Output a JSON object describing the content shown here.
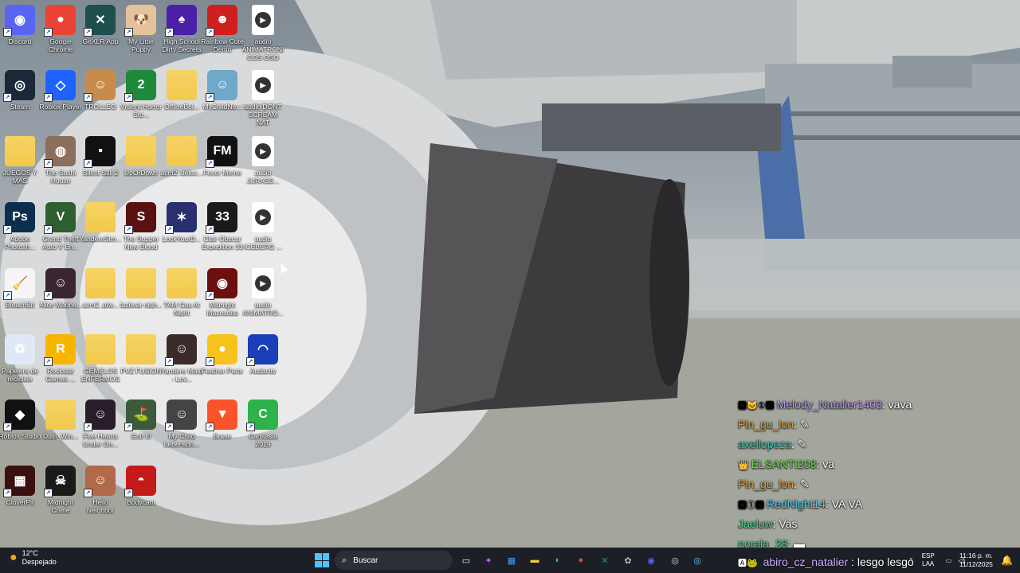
{
  "desktop_icons": [
    {
      "label": "Discord",
      "icon": "discord-icon",
      "color": "#5865f2",
      "glyph": "◉"
    },
    {
      "label": "Google Chrome",
      "icon": "chrome-icon",
      "color": "#ea4335",
      "glyph": "●"
    },
    {
      "label": "GeXLR App",
      "icon": "app-icon",
      "color": "#1e4f4f",
      "glyph": "✕"
    },
    {
      "label": "My Little Puppy",
      "icon": "puppy-icon",
      "color": "#e4c29a",
      "glyph": "🐶"
    },
    {
      "label": "High School Dirty Secrets",
      "icon": "game-icon",
      "color": "#4b1fa8",
      "glyph": "♠"
    },
    {
      "label": "Rainbow Cute Demo",
      "icon": "bear-icon",
      "color": "#d01f1f",
      "glyph": "☻"
    },
    {
      "label": "audio ANIMATRONICOS OSO NAT LARGO",
      "icon": "audio-file-icon",
      "color": "#ffffff",
      "glyph": "▶"
    },
    {
      "label": "Steam",
      "icon": "steam-icon",
      "color": "#1b2838",
      "glyph": "◎"
    },
    {
      "label": "Roblox Player",
      "icon": "roblox-icon",
      "color": "#1e62ff",
      "glyph": "◇"
    },
    {
      "label": "TROLLEO",
      "icon": "troll-icon",
      "color": "#c98b4a",
      "glyph": "☺"
    },
    {
      "label": "Violent Horror Sto...",
      "icon": "game-icon",
      "color": "#1c8a3a",
      "glyph": "2"
    },
    {
      "label": "OfflineBol...",
      "icon": "folder-icon",
      "color": "#f2c94c",
      "glyph": ""
    },
    {
      "label": "MyChildNe...",
      "icon": "game-icon",
      "color": "#6fa8c9",
      "glyph": "☺"
    },
    {
      "label": "audio DONT SCREAM NAT",
      "icon": "audio-file-icon",
      "color": "#ffffff",
      "glyph": "▶"
    },
    {
      "label": "JUEGOS Y MAS",
      "icon": "folder-icon",
      "color": "#f2c94c",
      "glyph": ""
    },
    {
      "label": "The Sushi House",
      "icon": "game-icon",
      "color": "#8a6f5c",
      "glyph": "◍"
    },
    {
      "label": "Silent Still 2",
      "icon": "game-icon",
      "color": "#111111",
      "glyph": "▪"
    },
    {
      "label": "UpOrDown",
      "icon": "folder-icon",
      "color": "#f2c94c",
      "glyph": ""
    },
    {
      "label": "acm2_delux...",
      "icon": "folder-icon",
      "color": "#f2c94c",
      "glyph": ""
    },
    {
      "label": "Fever Meme",
      "icon": "game-icon",
      "color": "#111111",
      "glyph": "FM"
    },
    {
      "label": "audio JURASS...",
      "icon": "audio-file-icon",
      "color": "#ffffff",
      "glyph": "▶"
    },
    {
      "label": "Adobe Photosh...",
      "icon": "photoshop-icon",
      "color": "#0b2e4f",
      "glyph": "Ps"
    },
    {
      "label": "Grand Theft Auto V En...",
      "icon": "gta-icon",
      "color": "#2f5e2f",
      "glyph": "V"
    },
    {
      "label": "YandereSim...",
      "icon": "folder-icon",
      "color": "#f2c94c",
      "glyph": ""
    },
    {
      "label": "The Supper New Blood",
      "icon": "game-icon",
      "color": "#5a1111",
      "glyph": "S"
    },
    {
      "label": "LockYourD...",
      "icon": "game-icon",
      "color": "#2a2f6e",
      "glyph": "✶"
    },
    {
      "label": "Clair Obscur Expedition 33",
      "icon": "game-icon",
      "color": "#1a1a1a",
      "glyph": "33"
    },
    {
      "label": "audio ICEBERG ...",
      "icon": "audio-file-icon",
      "color": "#ffffff",
      "glyph": "▶"
    },
    {
      "label": "BleachBit",
      "icon": "bleachbit-icon",
      "color": "#f5f5f5",
      "glyph": "🧹"
    },
    {
      "label": "Alice Madne...",
      "icon": "game-icon",
      "color": "#3a2630",
      "glyph": "☺"
    },
    {
      "label": "acm2_pfw...",
      "icon": "folder-icon",
      "color": "#f2c94c",
      "glyph": ""
    },
    {
      "label": "fazbear nigh...",
      "icon": "folder-icon",
      "color": "#f2c94c",
      "glyph": ""
    },
    {
      "label": "TAM Gas At Night",
      "icon": "folder-icon",
      "color": "#f2c94c",
      "glyph": ""
    },
    {
      "label": "Midnight Mazesoba",
      "icon": "game-icon",
      "color": "#6b0f0f",
      "glyph": "◉"
    },
    {
      "label": "audio ANIMATRO...",
      "icon": "audio-file-icon",
      "color": "#ffffff",
      "glyph": "▶"
    },
    {
      "label": "Papelera de reciclaje",
      "icon": "recycle-bin-icon",
      "color": "#dfe9f5",
      "glyph": "♻"
    },
    {
      "label": "Rockstar Games ...",
      "icon": "rockstar-icon",
      "color": "#f7b500",
      "glyph": "R"
    },
    {
      "label": "GEMELOS ENFERMOS",
      "icon": "folder-icon",
      "color": "#f2c94c",
      "glyph": ""
    },
    {
      "label": "PVZ FUSION",
      "icon": "folder-icon",
      "color": "#f2c94c",
      "glyph": ""
    },
    {
      "label": "Yandere Maid - Lov...",
      "icon": "game-icon",
      "color": "#3b2b2b",
      "glyph": "☺"
    },
    {
      "label": "Feather Party",
      "icon": "game-icon",
      "color": "#f6c21c",
      "glyph": "●"
    },
    {
      "label": "Audacity",
      "icon": "audacity-icon",
      "color": "#1a3fb8",
      "glyph": "◠"
    },
    {
      "label": "Roblox Studio",
      "icon": "roblox-studio-icon",
      "color": "#111111",
      "glyph": "◆"
    },
    {
      "label": "Dust_Win...",
      "icon": "folder-icon",
      "color": "#f2c94c",
      "glyph": ""
    },
    {
      "label": "Five Hearts Under On...",
      "icon": "game-icon",
      "color": "#2a1d2a",
      "glyph": "☺"
    },
    {
      "label": "Golf It!",
      "icon": "game-icon",
      "color": "#3c5a3c",
      "glyph": "⛳"
    },
    {
      "label": "My Child Lebensbo...",
      "icon": "game-icon",
      "color": "#444444",
      "glyph": "☺"
    },
    {
      "label": "Brave",
      "icon": "brave-icon",
      "color": "#fb542b",
      "glyph": "▼"
    },
    {
      "label": "Camtasia 2019",
      "icon": "camtasia-icon",
      "color": "#2db34a",
      "glyph": "C"
    },
    {
      "label": "CloverPit",
      "icon": "game-icon",
      "color": "#3a1010",
      "glyph": "▦"
    },
    {
      "label": "Midnight Crane",
      "icon": "game-icon",
      "color": "#1a1a1a",
      "glyph": "☠"
    },
    {
      "label": "Hello Neighbor",
      "icon": "game-icon",
      "color": "#b06a4a",
      "glyph": "☺"
    },
    {
      "label": "Bodycam",
      "icon": "game-icon",
      "color": "#c41a1a",
      "glyph": "◓"
    }
  ],
  "chat": [
    {
      "badges": "🅰🐱①🅶",
      "user": "Melody_Natalier1403",
      "color": "#b892e8",
      "msg": ": vava"
    },
    {
      "badges": "",
      "user": "Pin_gu_lon",
      "color": "#d9a13a",
      "msg": ": ✎"
    },
    {
      "badges": "",
      "user": "axellopeza",
      "color": "#3cc7b3",
      "msg": ": ✎"
    },
    {
      "badges": "👑",
      "user": "ELSANTI208",
      "color": "#6adf3a",
      "msg": ": va"
    },
    {
      "badges": "",
      "user": "Pin_gu_lon",
      "color": "#d9a13a",
      "msg": ": ✎"
    },
    {
      "badges": "🅰①🅶",
      "user": "RedNight14",
      "color": "#4fc3e6",
      "msg": ": VA VA"
    },
    {
      "badges": "",
      "user": "Jaeluw",
      "color": "#4fd48a",
      "msg": ": Vas"
    },
    {
      "badges": "",
      "user": "norala_28",
      "color": "#4fd48a",
      "msg": ": ▬"
    }
  ],
  "chat_overlay": {
    "badges": "🅰🐸",
    "user": "abiro_cz_natalier",
    "color": "#cfa8ff",
    "msg": ": lesgo lesgo"
  },
  "taskbar": {
    "weather": {
      "temp": "12°C",
      "condition": "Despejado"
    },
    "search_placeholder": "Buscar",
    "apps": [
      {
        "name": "task-view-icon",
        "glyph": "▭",
        "color": "#ffffff"
      },
      {
        "name": "copilot-icon",
        "glyph": "✦",
        "color": "#c060ff"
      },
      {
        "name": "store-icon",
        "glyph": "▦",
        "color": "#3aa0ff"
      },
      {
        "name": "file-explorer-icon",
        "glyph": "▬",
        "color": "#f2c94c"
      },
      {
        "name": "edge-icon",
        "glyph": "◐",
        "color": "#2ec4a5"
      },
      {
        "name": "chrome-icon",
        "glyph": "●",
        "color": "#ea4335"
      },
      {
        "name": "app-icon",
        "glyph": "✕",
        "color": "#2f8f8f"
      },
      {
        "name": "settings-icon",
        "glyph": "✿",
        "color": "#bbbbbb"
      },
      {
        "name": "discord-icon",
        "glyph": "◉",
        "color": "#5865f2"
      },
      {
        "name": "obs-icon",
        "glyph": "◎",
        "color": "#d0d0d0"
      },
      {
        "name": "steam-icon",
        "glyph": "◎",
        "color": "#66c0f4"
      }
    ],
    "language": {
      "top": "ESP",
      "bottom": "LAA"
    },
    "time": "11:16 p. m.",
    "date": "11/12/2025"
  }
}
